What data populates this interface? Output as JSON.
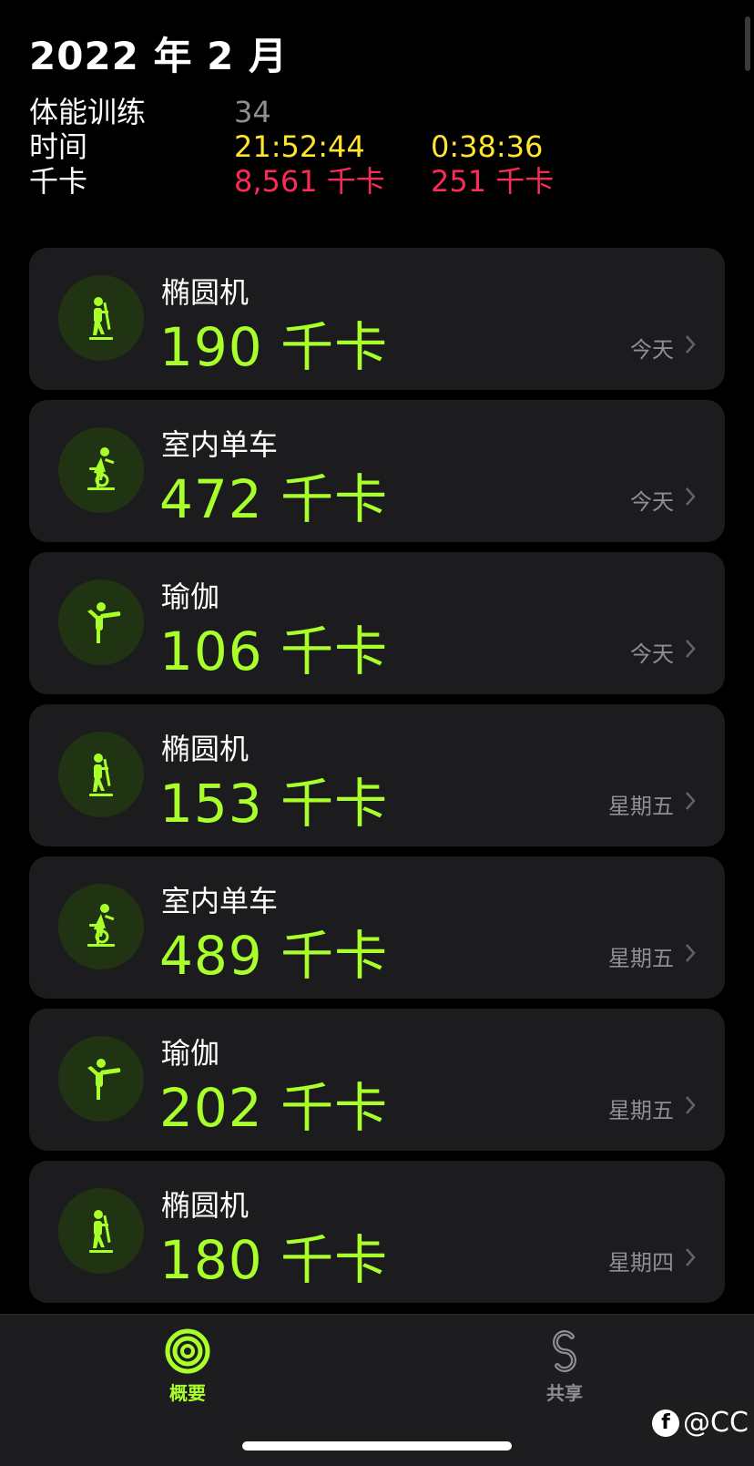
{
  "header": {
    "title": "2022 年 2 月"
  },
  "summary": {
    "workouts": {
      "label": "体能训练",
      "value": "34"
    },
    "time": {
      "label": "时间",
      "total": "21:52:44",
      "average": "0:38:36"
    },
    "calories": {
      "label": "千卡",
      "total": "8,561 千卡",
      "average": "251 千卡"
    }
  },
  "workouts": [
    {
      "name": "椭圆机",
      "calories": "190 千卡",
      "date": "今天",
      "icon": "elliptical-icon"
    },
    {
      "name": "室内单车",
      "calories": "472 千卡",
      "date": "今天",
      "icon": "indoor-cycle-icon"
    },
    {
      "name": "瑜伽",
      "calories": "106 千卡",
      "date": "今天",
      "icon": "yoga-icon"
    },
    {
      "name": "椭圆机",
      "calories": "153 千卡",
      "date": "星期五",
      "icon": "elliptical-icon"
    },
    {
      "name": "室内单车",
      "calories": "489 千卡",
      "date": "星期五",
      "icon": "indoor-cycle-icon"
    },
    {
      "name": "瑜伽",
      "calories": "202 千卡",
      "date": "星期五",
      "icon": "yoga-icon"
    },
    {
      "name": "椭圆机",
      "calories": "180 千卡",
      "date": "星期四",
      "icon": "elliptical-icon"
    }
  ],
  "tabs": [
    {
      "label": "概要",
      "icon": "activity-rings-icon",
      "active": true
    },
    {
      "label": "共享",
      "icon": "sharing-icon",
      "active": false
    }
  ],
  "watermark": {
    "text": "@CC",
    "icon": "app-logo-icon"
  },
  "colors": {
    "accent": "#a8ff2a",
    "time": "#ffe62e",
    "calories": "#fa2c55",
    "card": "#1c1c1e"
  }
}
